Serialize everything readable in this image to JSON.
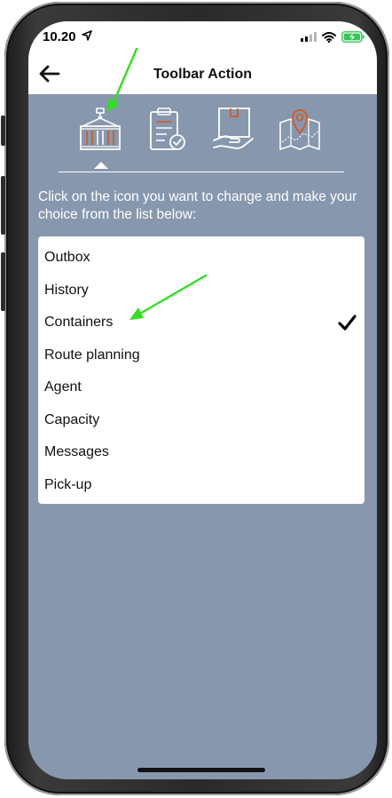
{
  "status_bar": {
    "time": "10.20"
  },
  "nav": {
    "title": "Toolbar Action"
  },
  "toolbar": {
    "icons": [
      "containers-icon",
      "clipboard-check-icon",
      "package-hand-icon",
      "map-pin-icon"
    ],
    "selected_index": 0
  },
  "instruction": "Click on the icon you want to change and make your choice from the list below:",
  "options": [
    {
      "label": "Outbox",
      "selected": false
    },
    {
      "label": "History",
      "selected": false
    },
    {
      "label": "Containers",
      "selected": true
    },
    {
      "label": "Route planning",
      "selected": false
    },
    {
      "label": "Agent",
      "selected": false
    },
    {
      "label": "Capacity",
      "selected": false
    },
    {
      "label": "Messages",
      "selected": false
    },
    {
      "label": "Pick-up",
      "selected": false
    }
  ],
  "colors": {
    "screen_bg": "#8797ae",
    "icon_accent": "#c8602b",
    "annotation_arrow": "#2fe020",
    "battery_green": "#34c759"
  }
}
